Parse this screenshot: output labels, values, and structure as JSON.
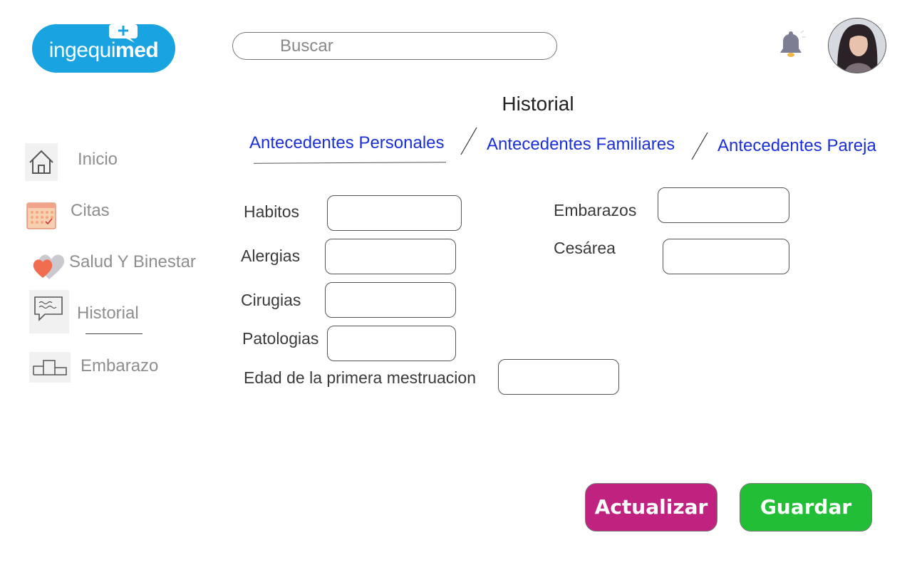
{
  "header": {
    "logo": {
      "text_light": "ingequi",
      "text_bold": "med"
    },
    "search": {
      "placeholder": "Buscar"
    },
    "bell_icon": "bell-icon",
    "avatar": "user-avatar"
  },
  "sidebar": {
    "items": [
      {
        "label": "Inicio",
        "icon": "home-icon"
      },
      {
        "label": "Citas",
        "icon": "calendar-icon"
      },
      {
        "label": "Salud Y Binestar",
        "icon": "heart-icon"
      },
      {
        "label": "Historial",
        "icon": "chat-bubble-icon",
        "active": true
      },
      {
        "label": "Embarazo",
        "icon": "podium-icon"
      }
    ]
  },
  "main": {
    "title": "Historial",
    "tabs": [
      {
        "label": "Antecedentes Personales",
        "active": true
      },
      {
        "label": "Antecedentes Familiares"
      },
      {
        "label": "Antecedentes Pareja"
      }
    ],
    "form": {
      "habitos": {
        "label": "Habitos",
        "value": ""
      },
      "alergias": {
        "label": "Alergias",
        "value": ""
      },
      "cirugias": {
        "label": "Cirugias",
        "value": ""
      },
      "patologias": {
        "label": "Patologias",
        "value": ""
      },
      "primera_mestruacion": {
        "label": "Edad de la primera mestruacion",
        "value": ""
      },
      "embarazos": {
        "label": "Embarazos",
        "value": ""
      },
      "cesarea": {
        "label": "Cesárea",
        "value": ""
      }
    },
    "buttons": {
      "actualizar": "Actualizar",
      "guardar": "Guardar"
    }
  },
  "colors": {
    "brand": "#19a3e0",
    "tab_link": "#1a2fd6",
    "actualizar": "#c02280",
    "guardar": "#22bf36"
  }
}
